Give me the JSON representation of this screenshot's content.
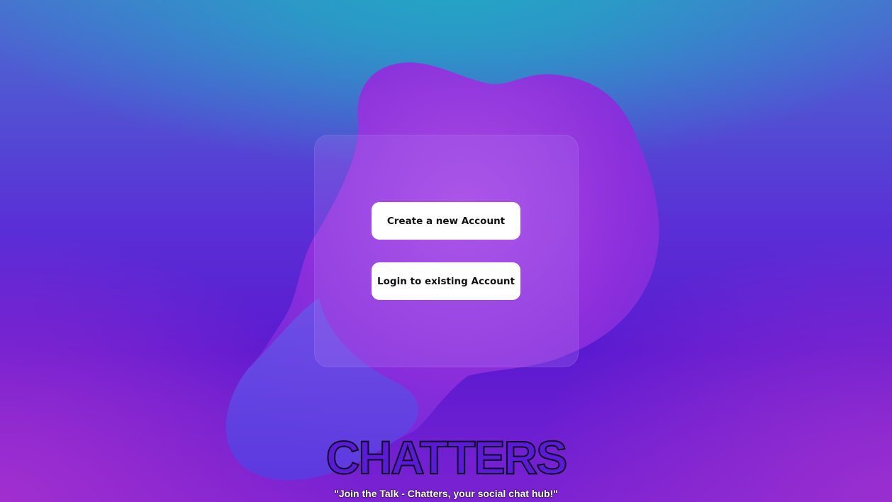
{
  "actions": {
    "create_label": "Create a new Account",
    "login_label": "Login to existing Account"
  },
  "brand": {
    "name": "CHATTERS",
    "tagline": "\"Join the Talk - Chatters, your social chat hub!\""
  },
  "colors": {
    "button_bg": "#ffffff",
    "button_text": "#111111",
    "background_top": "#22a6c4",
    "background_mid": "#5a2fd6",
    "blob": "#9b3be0"
  }
}
